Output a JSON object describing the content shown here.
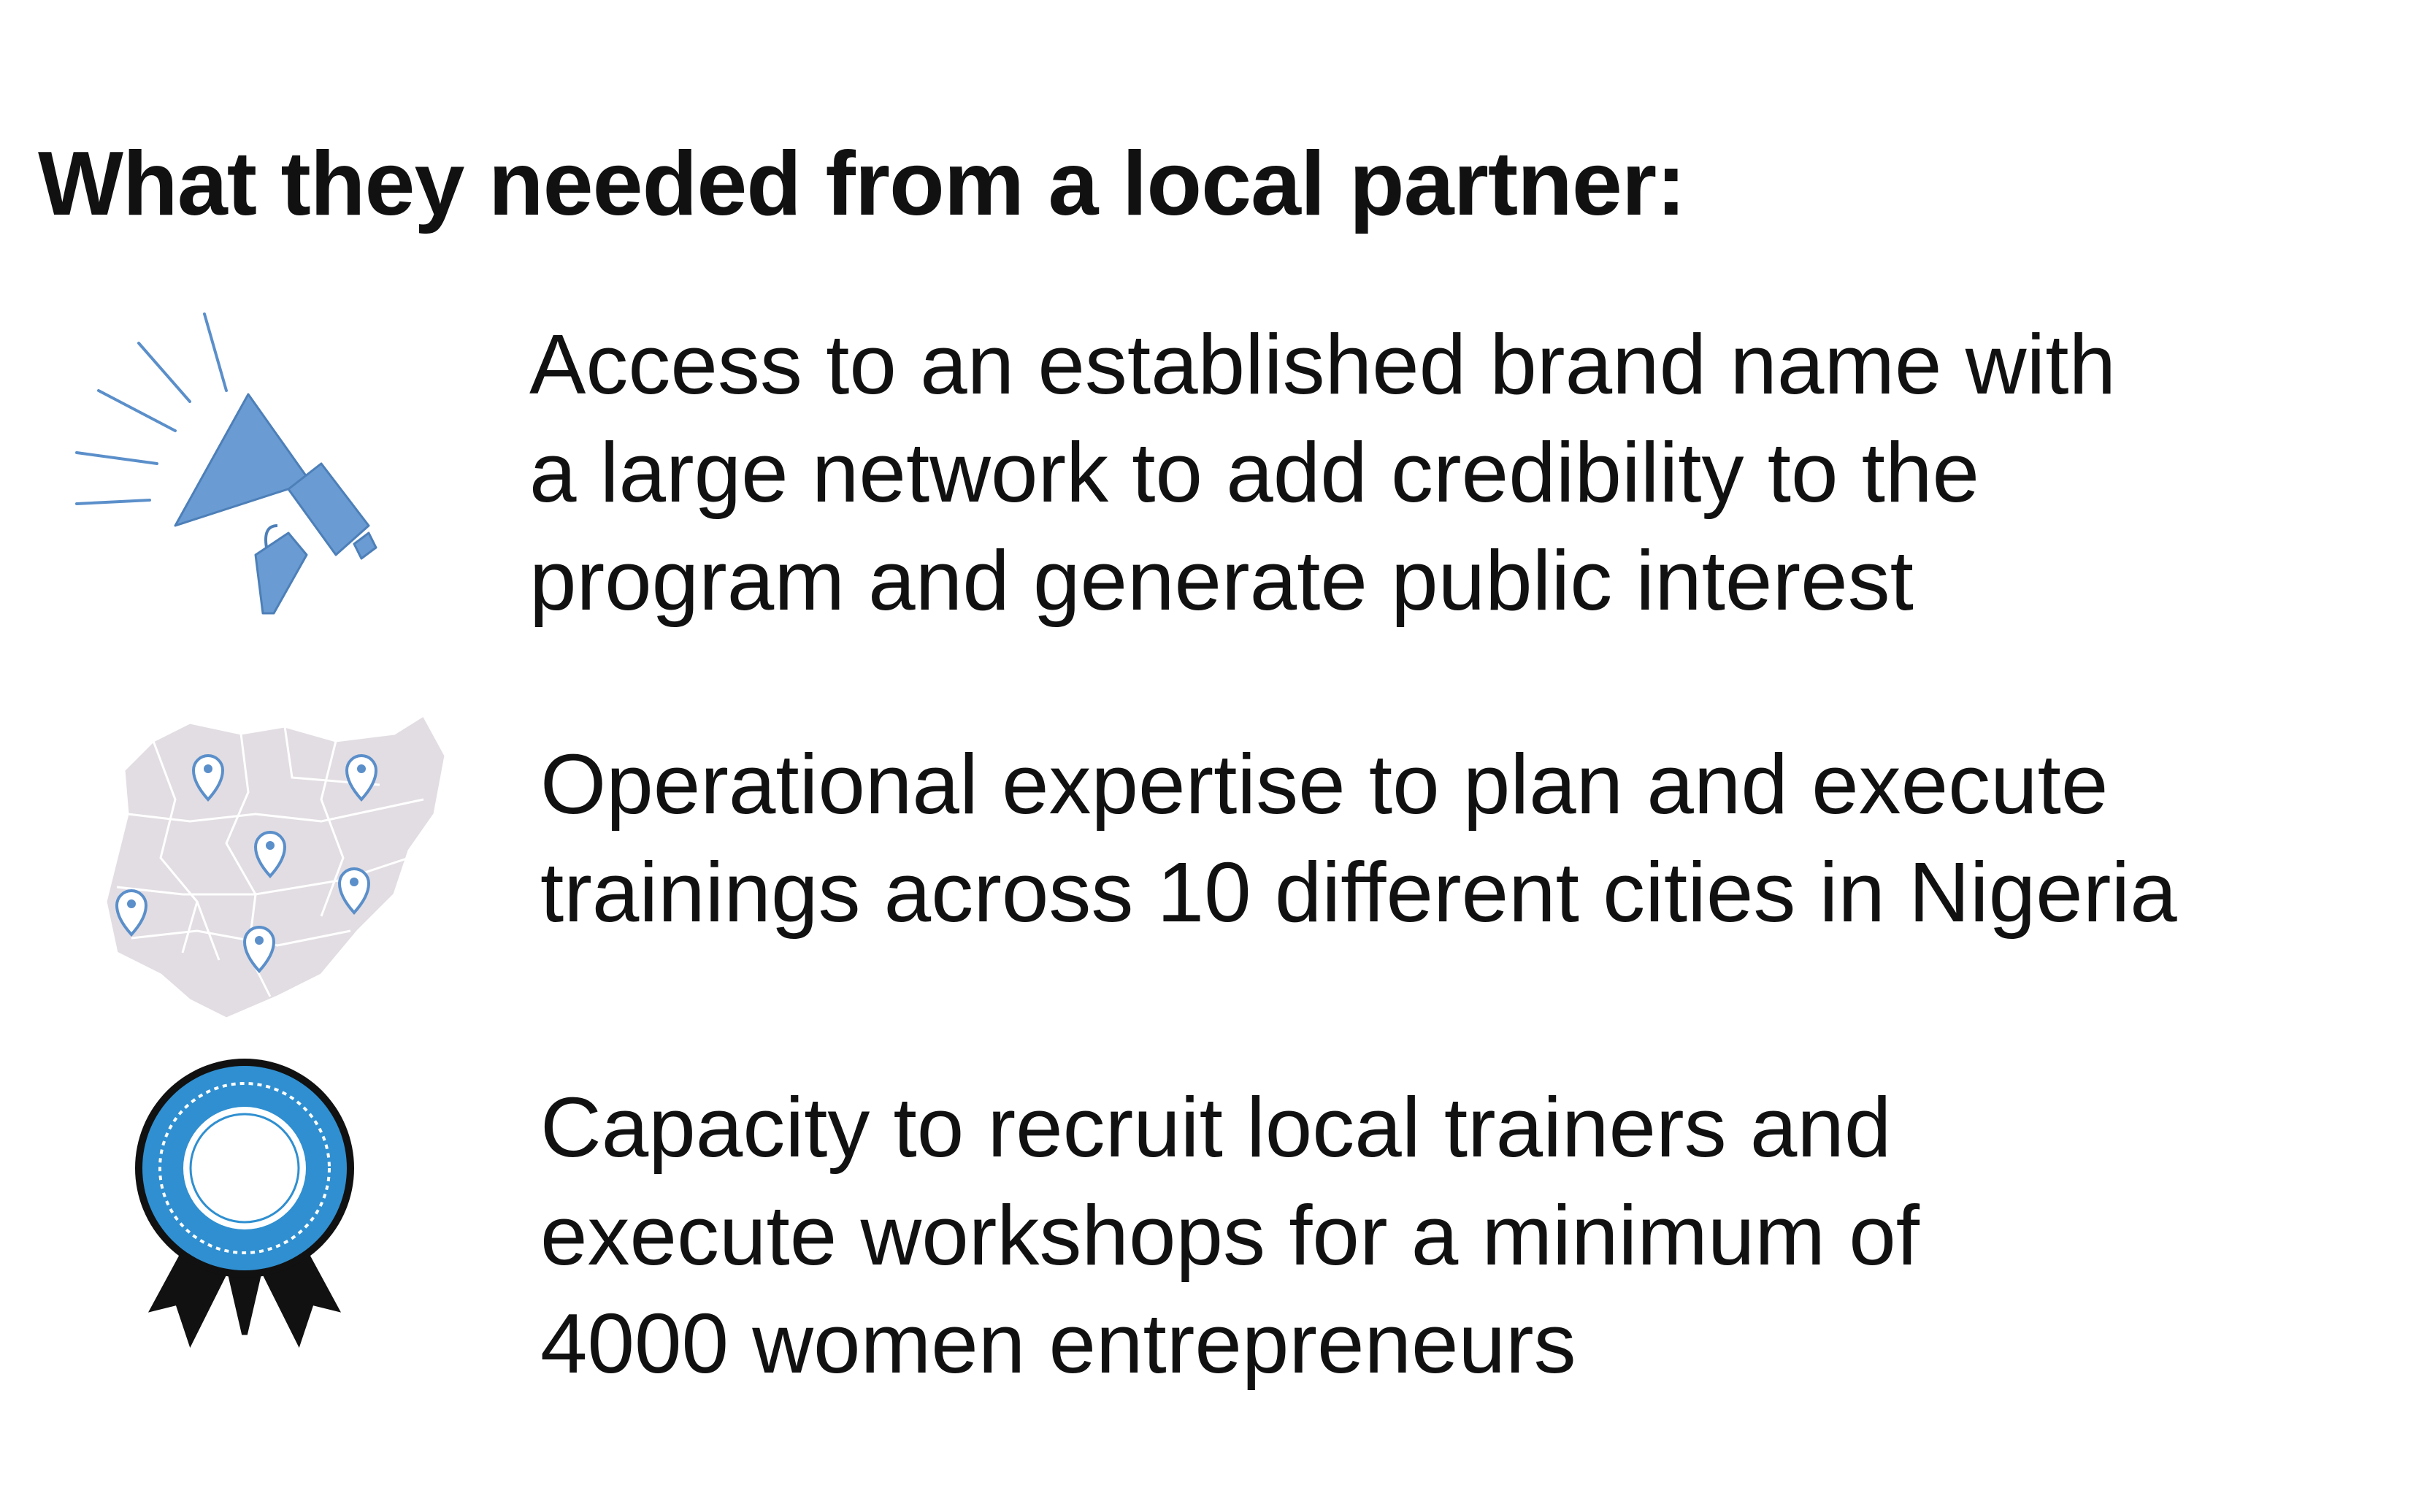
{
  "heading": "What they needed from a local partner:",
  "items": [
    {
      "icon": "megaphone-icon",
      "lines": [
        "Access to an established brand name with",
        "a large network to add credibility to the",
        "program and generate public interest"
      ]
    },
    {
      "icon": "nigeria-map-icon",
      "lines": [
        "Operational expertise to plan and execute",
        "trainings across 10 different cities in Nigeria"
      ]
    },
    {
      "icon": "award-ribbon-icon",
      "lines": [
        "Capacity to recruit local trainers and",
        "execute workshops for a minimum of",
        "4000 women entrepreneurs"
      ]
    }
  ],
  "colors": {
    "accent_blue": "#5b8fca",
    "ribbon_blue": "#2f8fd0",
    "map_gray": "#e2dde2",
    "text": "#111111"
  }
}
